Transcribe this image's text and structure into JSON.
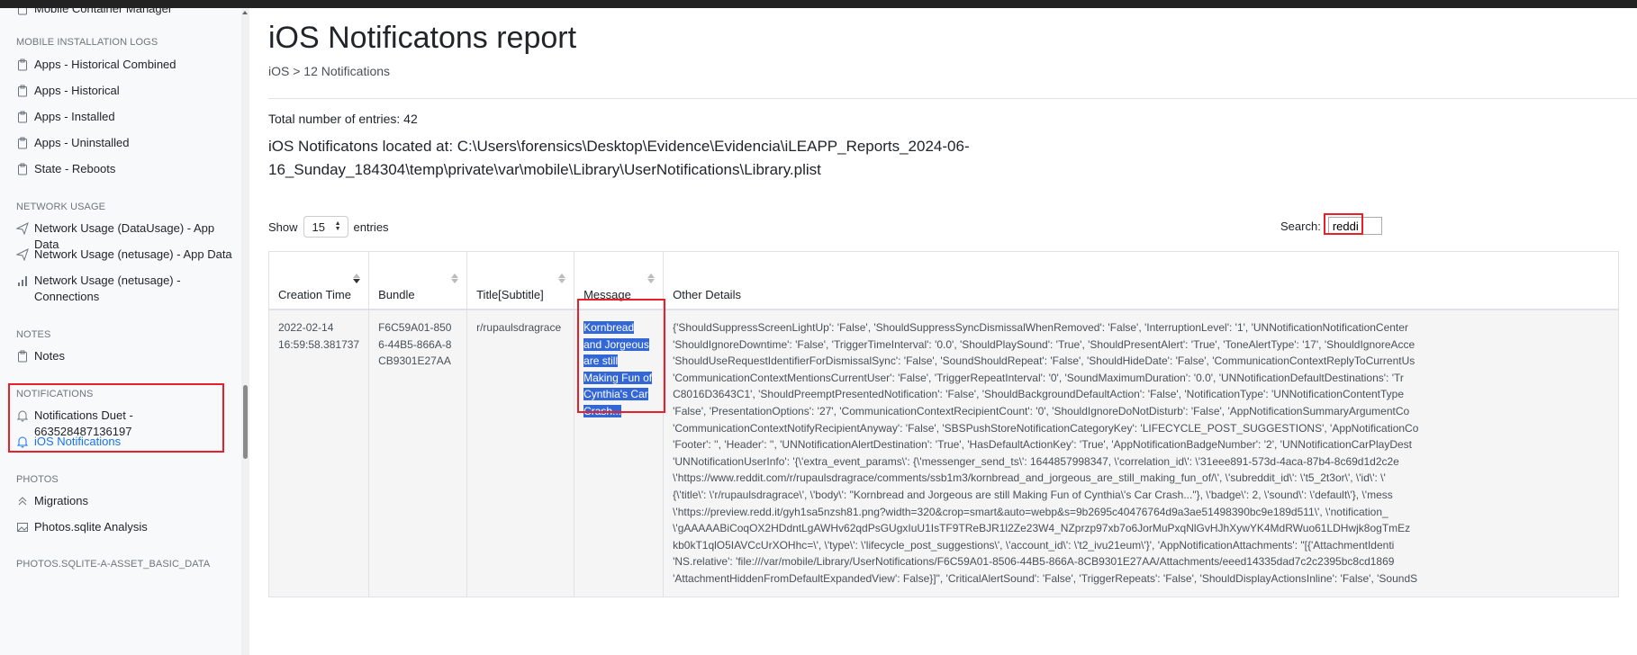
{
  "sidebar": {
    "top_item": "Mobile Container Manager",
    "sections": [
      {
        "heading": "MOBILE INSTALLATION LOGS",
        "items": [
          "Apps - Historical Combined",
          "Apps - Historical",
          "Apps - Installed",
          "Apps - Uninstalled",
          "State - Reboots"
        ]
      },
      {
        "heading": "NETWORK USAGE",
        "items": [
          "Network Usage (DataUsage) - App Data",
          "Network Usage (netusage) - App Data",
          "Network Usage (netusage) - Connections"
        ]
      },
      {
        "heading": "NOTES",
        "items": [
          "Notes"
        ]
      },
      {
        "heading": "NOTIFICATIONS",
        "items": [
          "Notifications Duet - 663528487136197",
          "iOS Notifications"
        ]
      },
      {
        "heading": "PHOTOS",
        "items": [
          "Migrations",
          "Photos.sqlite Analysis"
        ]
      },
      {
        "heading": "PHOTOS.SQLITE-A-ASSET_BASIC_DATA"
      }
    ]
  },
  "page": {
    "title": "iOS Notificatons report",
    "breadcrumb": "iOS > 12 Notifications",
    "total": "Total number of entries: 42",
    "location": "iOS Notificatons located at: C:\\Users\\forensics\\Desktop\\Evidence\\Evidencia\\iLEAPP_Reports_2024-06-16_Sunday_184304\\temp\\private\\var\\mobile\\Library\\UserNotifications\\Library.plist"
  },
  "controls": {
    "show_label": "Show",
    "entries_value": "15",
    "entries_label": "entries",
    "search_label": "Search:",
    "search_value": "reddi"
  },
  "table": {
    "headers": [
      "Creation Time",
      "Bundle",
      "Title[Subtitle]",
      "Message",
      "Other Details"
    ],
    "row": {
      "creation_time": "2022-02-14 16:59:58.381737",
      "bundle": "F6C59A01-8506-44B5-866A-8CB9301E27AA",
      "title": "r/rupaulsdragrace",
      "message": "Kornbread and Jorgeous are still Making Fun of Cynthia's Car Crash...",
      "details": [
        "{'ShouldSuppressScreenLightUp': 'False', 'ShouldSuppressSyncDismissalWhenRemoved': 'False', 'InterruptionLevel': '1', 'UNNotificationNotificationCenter",
        "'ShouldIgnoreDowntime': 'False', 'TriggerTimeInterval': '0.0', 'ShouldPlaySound': 'True', 'ShouldPresentAlert': 'True', 'ToneAlertType': '17', 'ShouldIgnoreAcce",
        "'ShouldUseRequestIdentifierForDismissalSync': 'False', 'SoundShouldRepeat': 'False', 'ShouldHideDate': 'False', 'CommunicationContextReplyToCurrentUs",
        "'CommunicationContextMentionsCurrentUser': 'False', 'TriggerRepeatInterval': '0', 'SoundMaximumDuration': '0.0', 'UNNotificationDefaultDestinations': 'Tr",
        "C8016D3643C1', 'ShouldPreemptPresentedNotification': 'False', 'ShouldBackgroundDefaultAction': 'False', 'NotificationType': 'UNNotificationContentType",
        "'False', 'PresentationOptions': '27', 'CommunicationContextRecipientCount': '0', 'ShouldIgnoreDoNotDisturb': 'False', 'AppNotificationSummaryArgumentCo",
        "'CommunicationContextNotifyRecipientAnyway': 'False', 'SBSPushStoreNotificationCategoryKey': 'LIFECYCLE_POST_SUGGESTIONS', 'AppNotificationCo",
        "'Footer': '', 'Header': '', 'UNNotificationAlertDestination': 'True', 'HasDefaultActionKey': 'True', 'AppNotificationBadgeNumber': '2', 'UNNotificationCarPlayDest",
        "'UNNotificationUserInfo': '{\\'extra_event_params\\': {\\'messenger_send_ts\\': 1644857998347, \\'correlation_id\\': \\'31eee891-573d-4aca-87b4-8c69d1d2c2e",
        "\\'https://www.reddit.com/r/rupaulsdragrace/comments/ssb1m3/kornbread_and_jorgeous_are_still_making_fun_of/\\', \\'subreddit_id\\': \\'t5_2t3or\\', \\'id\\': \\'",
        "{\\'title\\': \\'r/rupaulsdragrace\\', \\'body\\': \"Kornbread and Jorgeous are still Making Fun of Cynthia\\'s Car Crash...\"}, \\'badge\\': 2, \\'sound\\': \\'default\\'}, \\'mess",
        "\\'https://preview.redd.it/gyh1sa5nzsh81.png?width=320&crop=smart&auto=webp&s=9b2695c40476764d9a3ae51498390bc9e189d511\\', \\'notification_",
        "\\'gAAAAABiCoqOX2HDdntLgAWHv62qdPsGUgxIuU1IsTF9TReBJR1l2Ze23W4_NZprzp97xb7o6JorMuPxqNlGvHJhXywYK4MdRWuo61LDHwjk8ogTmEz",
        "kb0kT1qlO5IAVCcUrXOHhc=\\', \\'type\\': \\'lifecycle_post_suggestions\\', \\'account_id\\': \\'t2_ivu21eum\\'}', 'AppNotificationAttachments': \"[{'AttachmentIdenti",
        "'NS.relative': 'file:///var/mobile/Library/UserNotifications/F6C59A01-8506-44B5-866A-8CB9301E27AA/Attachments/eeed14335dad7c2c2395bc8cd1869",
        "'AttachmentHiddenFromDefaultExpandedView': False}]\", 'CriticalAlertSound': 'False', 'TriggerRepeats': 'False', 'ShouldDisplayActionsInline': 'False', 'SoundS"
      ]
    }
  },
  "colors": {
    "highlight": "#3367d6",
    "redbox": "#e8202a",
    "active_link": "#1a73e8"
  }
}
